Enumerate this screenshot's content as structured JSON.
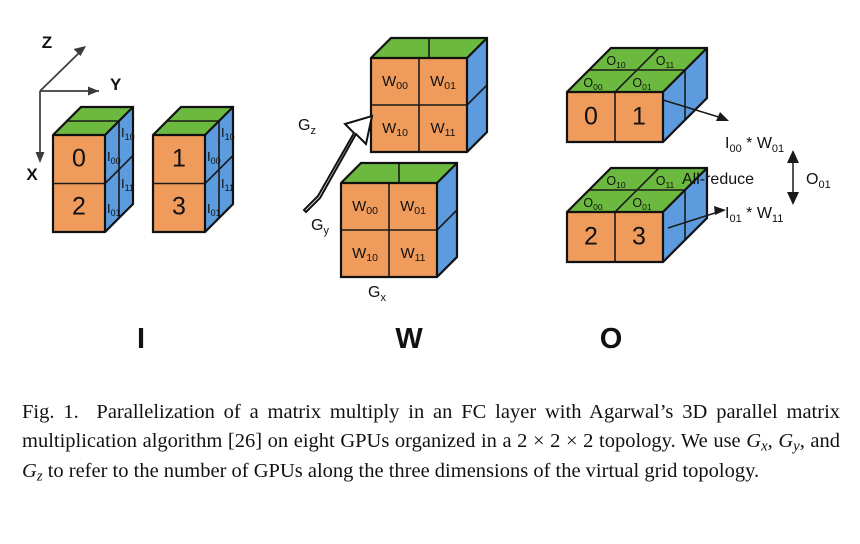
{
  "figure": {
    "axes": {
      "x_label": "X",
      "y_label": "Y",
      "z_label": "Z"
    },
    "matrix_labels": {
      "input": "I",
      "weight": "W",
      "output": "O"
    },
    "grid_labels": {
      "gx": "G",
      "gx_sub": "x",
      "gy": "G",
      "gy_sub": "y",
      "gz": "G",
      "gz_sub": "z"
    },
    "input_cubes": [
      {
        "name": "input-cube-left",
        "front_cells": [
          "0",
          "2"
        ],
        "side_cells": [
          "I",
          "I",
          "I",
          "I"
        ],
        "side_subs": [
          "10",
          "00",
          "11",
          "01"
        ]
      },
      {
        "name": "input-cube-right",
        "front_cells": [
          "1",
          "3"
        ],
        "side_cells": [
          "I",
          "I",
          "I",
          "I"
        ],
        "side_subs": [
          "10",
          "00",
          "11",
          "01"
        ]
      }
    ],
    "weight_cubes": [
      {
        "name": "weight-cube-back",
        "cells": [
          "W",
          "W",
          "W",
          "W"
        ],
        "subs": [
          "00",
          "01",
          "10",
          "11"
        ]
      },
      {
        "name": "weight-cube-front",
        "cells": [
          "W",
          "W",
          "W",
          "W"
        ],
        "subs": [
          "00",
          "01",
          "10",
          "11"
        ]
      }
    ],
    "output_cubes": [
      {
        "name": "output-cube-top",
        "front_cells": [
          "0",
          "1"
        ],
        "top_cells": [
          "O",
          "O",
          "O",
          "O"
        ],
        "top_subs": [
          "10",
          "11",
          "00",
          "01"
        ]
      },
      {
        "name": "output-cube-bottom",
        "front_cells": [
          "2",
          "3"
        ],
        "top_cells": [
          "O",
          "O",
          "O",
          "O"
        ],
        "top_subs": [
          "10",
          "11",
          "00",
          "01"
        ]
      }
    ],
    "annotations": {
      "product_top_base": "I",
      "product_top_sub1": "00",
      "product_top_op": " * W",
      "product_top_sub2": "01",
      "product_bottom_base": "I",
      "product_bottom_sub1": "01",
      "product_bottom_op": " * W",
      "product_bottom_sub2": "11",
      "allreduce": "All-reduce",
      "result_base": "O",
      "result_sub": "01"
    },
    "colors": {
      "front_face": "#ef9b5c",
      "top_face": "#6cb93f",
      "side_face": "#5c9bdd",
      "edge": "#1a1a1a"
    }
  },
  "caption": {
    "fig_number": "Fig. 1.",
    "line1": "Parallelization of a matrix multiply in an FC layer with Agarwal’s",
    "line2": "3D parallel matrix multiplication algorithm [26] on eight GPUs organized in",
    "line3_a": "a 2 ",
    "line3_times1": "×",
    "line3_b": " 2 ",
    "line3_times2": "×",
    "line3_c": " 2 topology. We use ",
    "line3_g1": "G",
    "line3_g1sub": "x",
    "line3_d": ", ",
    "line3_g2": "G",
    "line3_g2sub": "y",
    "line3_e": ", and ",
    "line3_g3": "G",
    "line3_g3sub": "z",
    "line3_f": " to refer to the number of",
    "line4": "GPUs along the three dimensions of the virtual grid topology."
  }
}
